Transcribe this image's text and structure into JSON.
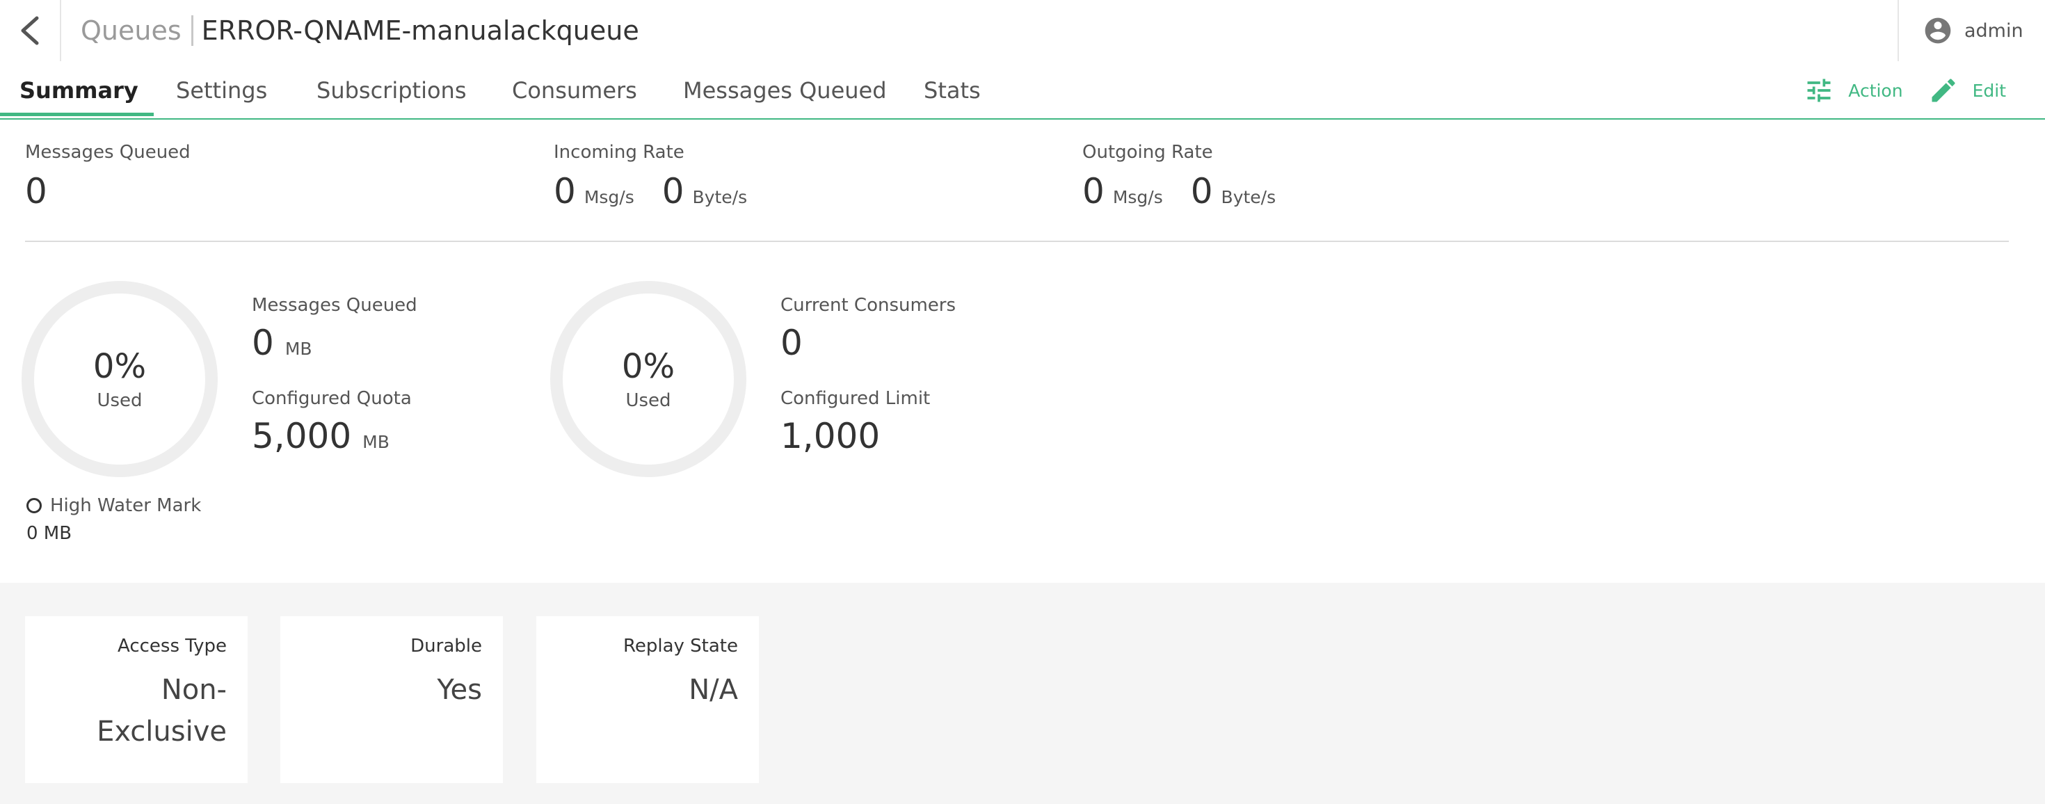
{
  "header": {
    "breadcrumb": "Queues",
    "queue_name": "ERROR-QNAME-manualackqueue",
    "user": "admin"
  },
  "tabs": [
    {
      "label": "Summary",
      "active": true
    },
    {
      "label": "Settings",
      "active": false
    },
    {
      "label": "Subscriptions",
      "active": false
    },
    {
      "label": "Consumers",
      "active": false
    },
    {
      "label": "Messages Queued",
      "active": false
    },
    {
      "label": "Stats",
      "active": false
    }
  ],
  "actions": {
    "action_label": "Action",
    "edit_label": "Edit"
  },
  "stats": {
    "messages_queued": {
      "label": "Messages Queued",
      "value": "0"
    },
    "incoming_rate": {
      "label": "Incoming Rate",
      "msg_value": "0",
      "msg_unit": "Msg/s",
      "byte_value": "0",
      "byte_unit": "Byte/s"
    },
    "outgoing_rate": {
      "label": "Outgoing Rate",
      "msg_value": "0",
      "msg_unit": "Msg/s",
      "byte_value": "0",
      "byte_unit": "Byte/s"
    }
  },
  "storage": {
    "gauge_percent": "0%",
    "gauge_label": "Used",
    "messages_queued_label": "Messages Queued",
    "messages_queued_value": "0",
    "messages_queued_unit": "MB",
    "quota_label": "Configured Quota",
    "quota_value": "5,000",
    "quota_unit": "MB",
    "high_water_mark_label": "High Water Mark",
    "high_water_mark_value": "0 MB"
  },
  "consumers": {
    "gauge_percent": "0%",
    "gauge_label": "Used",
    "current_label": "Current Consumers",
    "current_value": "0",
    "limit_label": "Configured Limit",
    "limit_value": "1,000"
  },
  "cards": [
    {
      "label": "Access Type",
      "value": "Non-Exclusive"
    },
    {
      "label": "Durable",
      "value": "Yes"
    },
    {
      "label": "Replay State",
      "value": "N/A"
    }
  ],
  "colors": {
    "accent": "#41b883",
    "gauge_track": "#eeeeee",
    "panel_bg": "#f5f5f5"
  }
}
